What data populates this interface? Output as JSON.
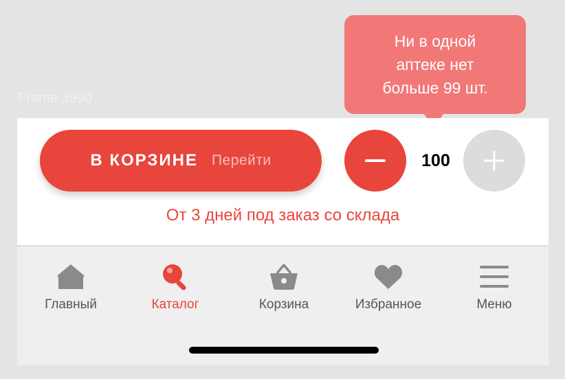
{
  "frame_label": "Frame 3990",
  "tooltip": {
    "lines": [
      "Ни в одной",
      "аптеке нет",
      "больше  99 шт."
    ]
  },
  "cart": {
    "button_label": "В КОРЗИНЕ",
    "go_label": "Перейти",
    "quantity": "100",
    "minus_icon": "minus-icon",
    "plus_icon": "plus-icon",
    "delivery_text": "От 3 дней под заказ со склада"
  },
  "tabbar": {
    "items": [
      {
        "label": "Главный",
        "icon": "home-icon",
        "active": false
      },
      {
        "label": "Каталог",
        "icon": "search-icon",
        "active": true
      },
      {
        "label": "Корзина",
        "icon": "basket-icon",
        "active": false
      },
      {
        "label": "Избранное",
        "icon": "heart-icon",
        "active": false
      },
      {
        "label": "Меню",
        "icon": "menu-icon",
        "active": false
      }
    ]
  },
  "colors": {
    "accent": "#e8453c",
    "tooltip": "#f27878",
    "inactive_icon": "#8a8a8a",
    "disabled_button": "#dcdcdc"
  }
}
